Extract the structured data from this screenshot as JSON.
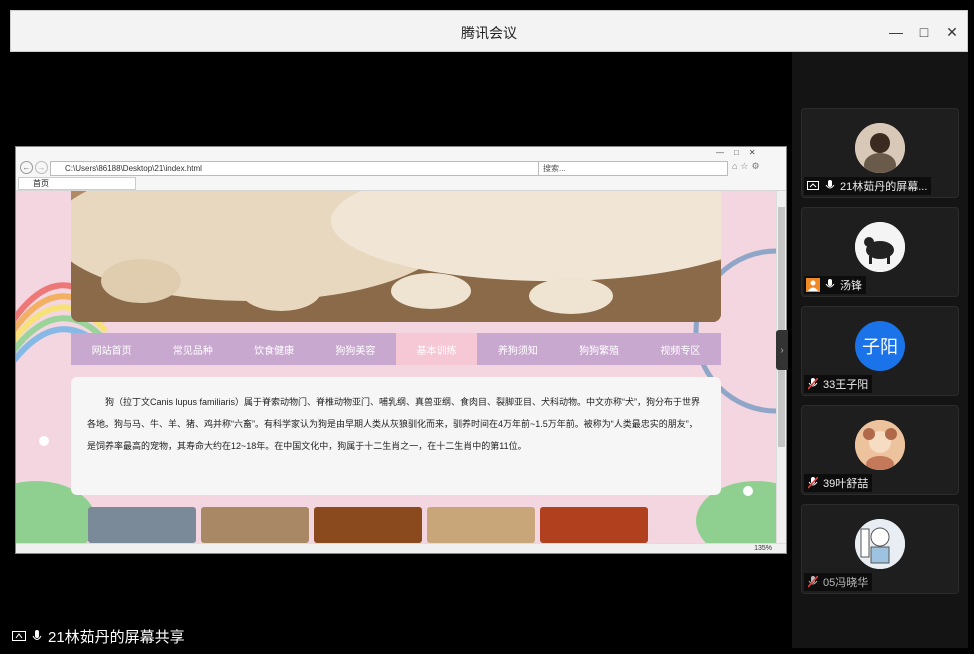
{
  "window": {
    "title": "腾讯会议"
  },
  "browser": {
    "address": "C:\\Users\\86188\\Desktop\\21\\index.html",
    "search_placeholder": "搜索...",
    "tab_label": "首页",
    "zoom": "135%"
  },
  "site": {
    "nav": [
      "网站首页",
      "常见品种",
      "饮食健康",
      "狗狗美容",
      "基本训练",
      "养狗须知",
      "狗狗繁殖",
      "视频专区"
    ],
    "active_nav_index": 4,
    "intro": "狗（拉丁文Canis lupus familiaris）属于脊索动物门、脊椎动物亚门、哺乳纲、真兽亚纲、食肉目、裂脚亚目、犬科动物。中文亦称“犬”，狗分布于世界各地。狗与马、牛、羊、猪、鸡并称“六畜”。有科学家认为狗是由早期人类从灰狼驯化而来，驯养时间在4万年前~1.5万年前。被称为“人类最忠实的朋友”，是饲养率最高的宠物，其寿命大约在12~18年。在中国文化中，狗属于十二生肖之一，在十二生肖中的第11位。"
  },
  "participants": [
    {
      "name": "21林茹丹的屏幕...",
      "mic": "on",
      "sharing": true,
      "avatar": "photo-woman"
    },
    {
      "name": "汤锋",
      "mic": "on",
      "sharing": false,
      "avatar": "cow-image"
    },
    {
      "name": "33王子阳",
      "mic": "muted",
      "sharing": false,
      "avatar_text": "子阳",
      "avatar_color": "#1a73e8"
    },
    {
      "name": "39叶舒喆",
      "mic": "muted",
      "sharing": false,
      "avatar": "cartoon-girl"
    },
    {
      "name": "05冯晓华",
      "mic": "muted",
      "sharing": false,
      "avatar": "cartoon-figure"
    }
  ],
  "share_label": "21林茹丹的屏幕共享",
  "colors": {
    "nav_bg": "#c9a8d0",
    "nav_active": "#f6c8d6",
    "page_bg": "#f3d6e0",
    "muted_mic": "#e04040",
    "on_mic": "#ffffff"
  }
}
